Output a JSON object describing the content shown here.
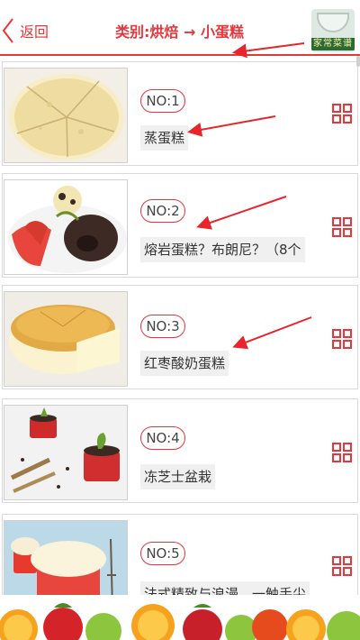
{
  "header": {
    "back_label": "返回",
    "title": "类别:烘焙 → 小蛋糕",
    "logo_text": "家常菜谱"
  },
  "items": [
    {
      "no": "NO:1",
      "name": "蒸蛋糕"
    },
    {
      "no": "NO:2",
      "name": "熔岩蛋糕？布朗尼？（8个"
    },
    {
      "no": "NO:3",
      "name": "红枣酸奶蛋糕"
    },
    {
      "no": "NO:4",
      "name": "冻芝士盆栽"
    },
    {
      "no": "NO:5",
      "name": "法式精致与浪漫，一触手尖"
    }
  ],
  "icons": {
    "back": "chevron-left-icon",
    "item_action": "grid-icon"
  },
  "colors": {
    "accent": "#e8363a",
    "chip_bg": "#f0f0f0",
    "border": "#d9d9d9"
  }
}
